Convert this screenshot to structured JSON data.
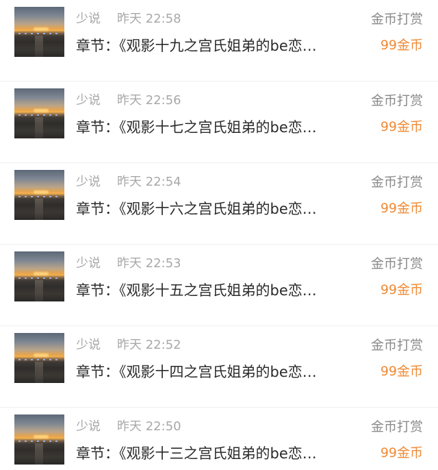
{
  "records": [
    {
      "source": "少说",
      "time": "昨天 22:58",
      "title": "章节：《观影十九之宫氏姐弟的be恋…",
      "type": "金币打赏",
      "amount": "99金币"
    },
    {
      "source": "少说",
      "time": "昨天 22:56",
      "title": "章节：《观影十七之宫氏姐弟的be恋…",
      "type": "金币打赏",
      "amount": "99金币"
    },
    {
      "source": "少说",
      "time": "昨天 22:54",
      "title": "章节：《观影十六之宫氏姐弟的be恋…",
      "type": "金币打赏",
      "amount": "99金币"
    },
    {
      "source": "少说",
      "time": "昨天 22:53",
      "title": "章节：《观影十五之宫氏姐弟的be恋…",
      "type": "金币打赏",
      "amount": "99金币"
    },
    {
      "source": "少说",
      "time": "昨天 22:52",
      "title": "章节：《观影十四之宫氏姐弟的be恋…",
      "type": "金币打赏",
      "amount": "99金币"
    },
    {
      "source": "少说",
      "time": "昨天 22:50",
      "title": "章节：《观影十三之宫氏姐弟的be恋…",
      "type": "金币打赏",
      "amount": "99金币"
    }
  ],
  "colors": {
    "secondary_text": "#a8a8a8",
    "primary_text": "#2b2b2b",
    "label_text": "#8a8a8a",
    "amount_accent": "#f08a35",
    "divider": "#efefef"
  },
  "icons": {
    "thumbnail": "sunset-thumbnail-image"
  }
}
